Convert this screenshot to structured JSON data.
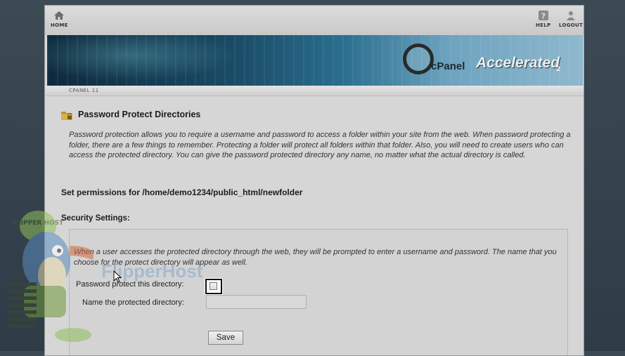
{
  "topbar": {
    "home_label": "HOME",
    "help_label": "HELP",
    "logout_label": "LOGOUT"
  },
  "banner": {
    "logo_c": "cPanel",
    "logo_accelerated": "Accelerated",
    "logo_version": "2"
  },
  "breadcrumb": "CPANEL 11",
  "page": {
    "title": "Password Protect Directories",
    "intro": "Password protection allows you to require a username and password to access a folder within your site from the web. When password protecting a folder, there are a few things to remember. Protecting a folder will protect all folders within that folder. Also, you will need to create users who can access the protected directory. You can give the password protected directory any name, no matter what the actual directory is called.",
    "permissions_heading": "Set permissions for /home/demo1234/public_html/newfolder",
    "security_heading": "Security Settings:",
    "security_description": "When a user accesses the protected directory through the web, they will be prompted to enter a username and password. The name that you choose for the protect directory will appear as well.",
    "protect_label": "Password protect this directory:",
    "protect_checked": false,
    "name_label": "Name the protected directory:",
    "name_value": "",
    "save_label": "Save"
  },
  "overlay": {
    "watermark": "FlipperHost",
    "mascot_badge": "FLIPPER HOST"
  },
  "colors": {
    "banner_dark": "#0e2a3d",
    "banner_light": "#8fb8cd",
    "highlight_border": "#111111"
  }
}
